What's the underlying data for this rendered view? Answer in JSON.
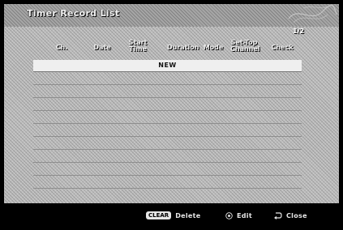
{
  "window": {
    "title": "Timer Record List",
    "page_indicator": "1/2"
  },
  "table": {
    "columns": [
      {
        "key": "ch",
        "label": "Ch."
      },
      {
        "key": "date",
        "label": "Date"
      },
      {
        "key": "start_time",
        "label": "Start\nTime"
      },
      {
        "key": "duration",
        "label": "Duration"
      },
      {
        "key": "mode",
        "label": "Mode"
      },
      {
        "key": "settop_channel",
        "label": "Set-Top\nChannel"
      },
      {
        "key": "check",
        "label": "Check"
      }
    ],
    "rows": [
      {
        "label": "NEW",
        "selected": true
      },
      {
        "label": ""
      },
      {
        "label": ""
      },
      {
        "label": ""
      },
      {
        "label": ""
      },
      {
        "label": ""
      },
      {
        "label": ""
      },
      {
        "label": ""
      },
      {
        "label": ""
      },
      {
        "label": ""
      }
    ]
  },
  "footer": {
    "hints": [
      {
        "key_label": "CLEAR",
        "label": "Delete",
        "icon": "clear-button-icon"
      },
      {
        "key_label": "",
        "label": "Edit",
        "icon": "enter-button-icon"
      },
      {
        "key_label": "",
        "label": "Close",
        "icon": "return-arrow-icon"
      }
    ]
  },
  "colors": {
    "panel": "#bdbdbd",
    "selected_row": "#efefef",
    "footer": "#000000",
    "text_light": "#eeeeee"
  }
}
